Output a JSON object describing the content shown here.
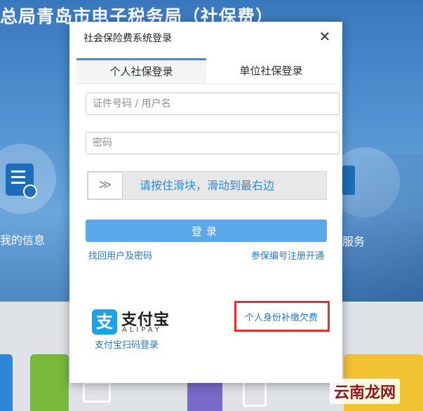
{
  "background": {
    "page_title": "总局青岛市电子税务局（社保费）",
    "tile_left_label": "我的信息",
    "tile_right_label": "服务",
    "watermark": "云南龙网"
  },
  "dialog": {
    "title": "社会保险费系统登录",
    "close_glyph": "✕",
    "tabs": [
      {
        "label": "个人社保登录",
        "active": true
      },
      {
        "label": "单位社保登录",
        "active": false
      }
    ],
    "username": {
      "placeholder": "证件号码 / 用户名",
      "value": ""
    },
    "password": {
      "placeholder": "密码",
      "value": ""
    },
    "slider": {
      "handle_glyph": "≫",
      "text": "请按住滑块，滑动到最右边"
    },
    "login_label": "登录",
    "recover_link": "找回用户及密码",
    "register_link": "参保编号注册开通",
    "alipay": {
      "logo_glyph": "支",
      "name": "支付宝",
      "name_en": "ALIPAY",
      "scan_link": "支付宝扫码登录"
    },
    "makeup_payment_link": "个人身份补缴欠费"
  },
  "colors": {
    "accent": "#3a8fd8",
    "login_button": "#5aa8ea",
    "link": "#2778c4",
    "highlight": "#e0322f"
  }
}
